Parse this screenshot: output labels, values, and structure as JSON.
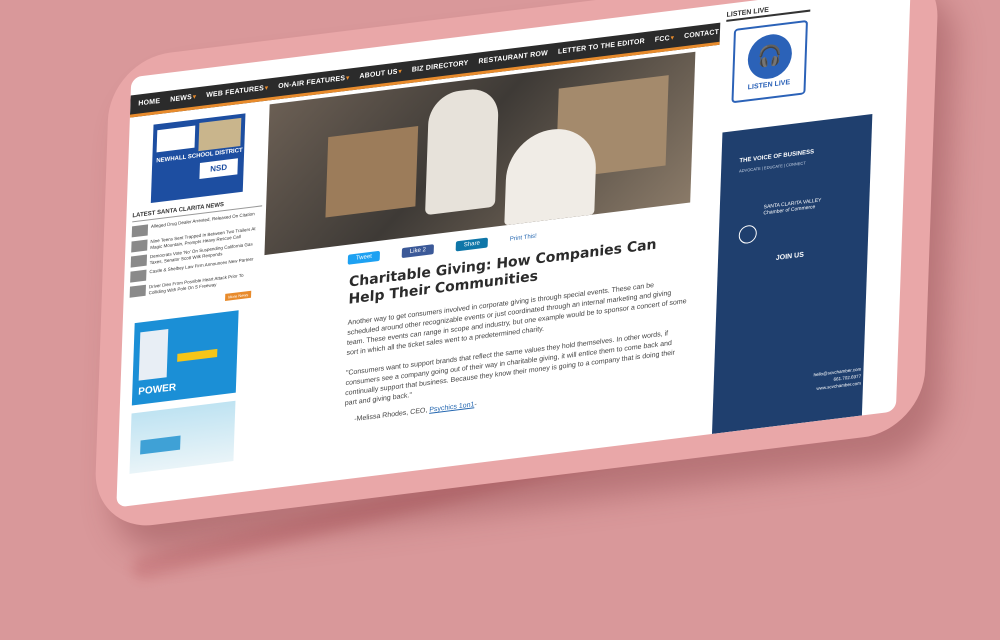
{
  "nav": {
    "items": [
      {
        "label": "HOME",
        "has_menu": false
      },
      {
        "label": "NEWS",
        "has_menu": true
      },
      {
        "label": "WEB FEATURES",
        "has_menu": true
      },
      {
        "label": "ON-AIR FEATURES",
        "has_menu": true
      },
      {
        "label": "ABOUT US",
        "has_menu": true
      },
      {
        "label": "BIZ DIRECTORY",
        "has_menu": false
      },
      {
        "label": "RESTAURANT ROW",
        "has_menu": false
      },
      {
        "label": "LETTER TO THE EDITOR",
        "has_menu": false
      },
      {
        "label": "FCC",
        "has_menu": true
      },
      {
        "label": "CONTACT US",
        "has_menu": false
      }
    ]
  },
  "left_sidebar": {
    "ad_top": {
      "district": "NEWHALL SCHOOL DISTRICT",
      "badge": "NSD"
    },
    "news_heading": "LATEST SANTA CLARITA NEWS",
    "news_items": [
      "Alleged Drug Dealer Arrested, Released On Citation",
      "Nine Teens Sent Trapped In Between Two Trailers At Magic Mountain, Prompts Heavy Rescue Call",
      "Democrats Vote 'No' On Suspending California Gas Taxes, Senator Scott Wilk Responds",
      "Castle & Shelbey Law Firm Announces New Partner",
      "Driver Dies From Possible Heart Attack Prior To Colliding With Pole On S Freeway"
    ],
    "more_label": "More News",
    "ad_power": {
      "brand": "POWER"
    }
  },
  "article": {
    "share": {
      "tweet": "Tweet",
      "like": "Like 2",
      "share": "Share",
      "print": "Print This!"
    },
    "title": "Charitable Giving: How Companies Can Help Their Communities",
    "paragraph": "Another way to get consumers involved in corporate giving is through special events. These can be scheduled around other recognizable events or just coordinated through an internal marketing and giving team. These events can range in scope and industry, but one example would be to sponsor a concert of some sort in which all the ticket sales went to a predetermined charity.",
    "quote": "\"Consumers want to support brands that reflect the same values they hold themselves. In other words, if consumers see a company going out of their way in charitable giving, it will entice them to come back and continually support that business. Because they know their money is going to a company that is doing their part and giving back.\"",
    "attribution_prefix": "-Melissa Rhodes, CEO,",
    "attribution_link": "Psychics 1on1",
    "attribution_suffix": "-"
  },
  "right_sidebar": {
    "listen_label": "LISTEN LIVE",
    "listen_button": "LISTEN LIVE",
    "chamber": {
      "voice": "THE VOICE OF BUSINESS",
      "sub": "ADVOCATE | EDUCATE | CONNECT",
      "org_top": "SANTA CLARITA VALLEY",
      "org_bottom": "Chamber of Commerce",
      "join": "JOIN US",
      "email": "hello@scvchamber.com",
      "phone": "661.702.6977",
      "site": "www.scvchamber.com"
    }
  },
  "colors": {
    "background": "#d9989a",
    "tablet": "#e9a7a8",
    "nav": "#2b2b2b",
    "accent": "#e88b2c",
    "chamber": "#1f3f6e",
    "link": "#2366b0"
  }
}
